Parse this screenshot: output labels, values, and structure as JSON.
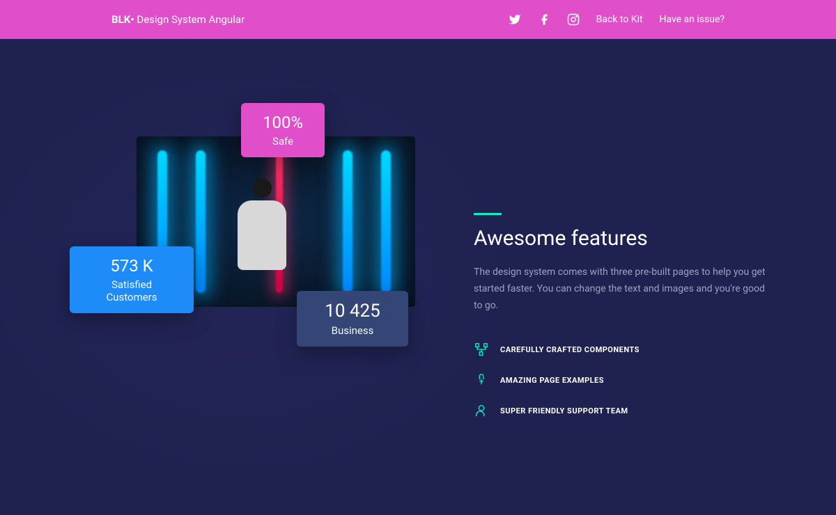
{
  "brand": {
    "bold": "BLK•",
    "rest": " Design System Angular"
  },
  "nav": {
    "link1": "Back to Kit",
    "link2": "Have an issue?"
  },
  "cards": {
    "pink": {
      "num": "100%",
      "label": "Safe"
    },
    "blue": {
      "num": "573 K",
      "label": "Satisfied Customers"
    },
    "dark": {
      "num": "10 425",
      "label": "Business"
    }
  },
  "section": {
    "title": "Awesome features",
    "desc": "The design system comes with three pre-built pages to help you get started faster. You can change the text and images and you're good to go."
  },
  "features": {
    "f1": "CAREFULLY CRAFTED COMPONENTS",
    "f2": "AMAZING PAGE EXAMPLES",
    "f3": "SUPER FRIENDLY SUPPORT TEAM"
  }
}
